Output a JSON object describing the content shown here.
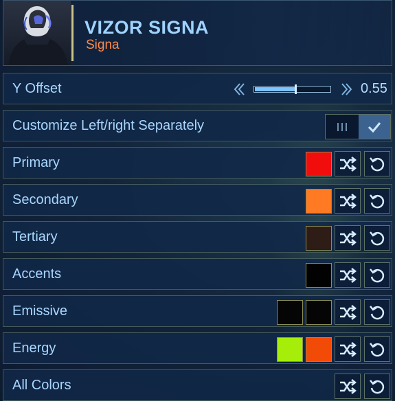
{
  "header": {
    "title": "VIZOR SIGNA",
    "subtitle": "Signa"
  },
  "slider": {
    "label": "Y Offset",
    "value_text": "0.55",
    "value": 0.55,
    "decrease_icon": "double-chevron-left-icon",
    "increase_icon": "double-chevron-right-icon"
  },
  "toggle": {
    "label": "Customize Left/right Separately",
    "checked": true,
    "off_icon": "bars-icon",
    "on_icon": "checkmark-icon"
  },
  "rows": [
    {
      "label": "Primary",
      "swatches": [
        "#f20d0d"
      ]
    },
    {
      "label": "Secondary",
      "swatches": [
        "#ff7a22"
      ]
    },
    {
      "label": "Tertiary",
      "swatches": [
        "#2e1c17"
      ]
    },
    {
      "label": "Accents",
      "swatches": [
        "#020202"
      ]
    },
    {
      "label": "Emissive",
      "swatches": [
        "#050505",
        "#050505"
      ]
    },
    {
      "label": "Energy",
      "swatches": [
        "#a6ee0a",
        "#f24b07"
      ]
    },
    {
      "label": "All Colors",
      "swatches": []
    }
  ],
  "icons": {
    "randomize": "shuffle-icon",
    "reset": "reset-icon"
  },
  "colors": {
    "text": "#a9d6ff",
    "title": "#9fd3ff",
    "subtitle": "#ff8a4a",
    "accent": "#7fc3ff"
  }
}
